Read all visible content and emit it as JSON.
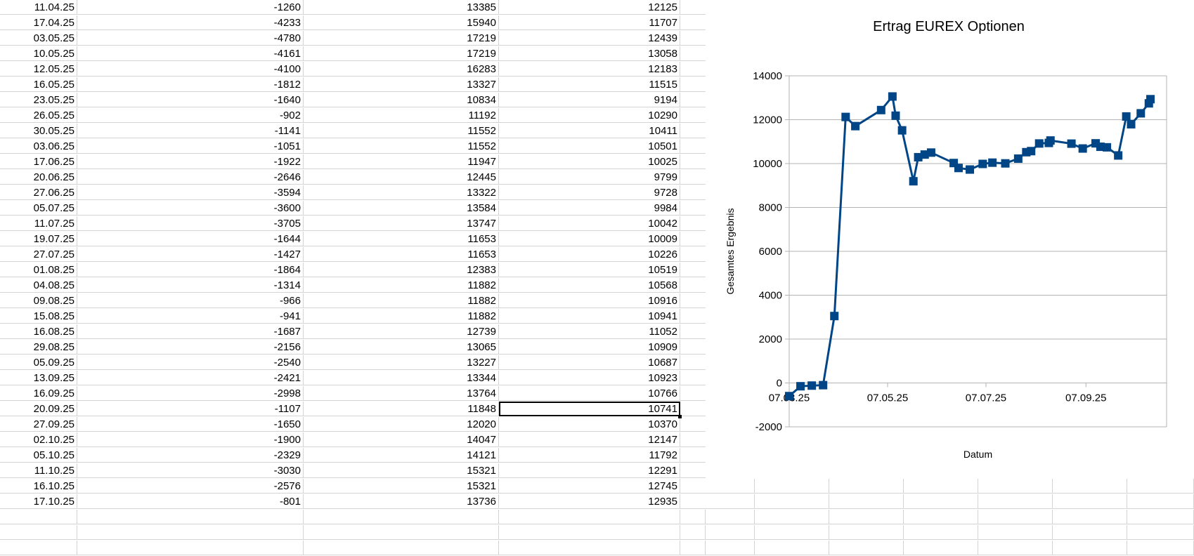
{
  "sheet": {
    "rows": [
      [
        "11.04.25",
        "-1260",
        "13385",
        "12125"
      ],
      [
        "17.04.25",
        "-4233",
        "15940",
        "11707"
      ],
      [
        "03.05.25",
        "-4780",
        "17219",
        "12439"
      ],
      [
        "10.05.25",
        "-4161",
        "17219",
        "13058"
      ],
      [
        "12.05.25",
        "-4100",
        "16283",
        "12183"
      ],
      [
        "16.05.25",
        "-1812",
        "13327",
        "11515"
      ],
      [
        "23.05.25",
        "-1640",
        "10834",
        "9194"
      ],
      [
        "26.05.25",
        "-902",
        "11192",
        "10290"
      ],
      [
        "30.05.25",
        "-1141",
        "11552",
        "10411"
      ],
      [
        "03.06.25",
        "-1051",
        "11552",
        "10501"
      ],
      [
        "17.06.25",
        "-1922",
        "11947",
        "10025"
      ],
      [
        "20.06.25",
        "-2646",
        "12445",
        "9799"
      ],
      [
        "27.06.25",
        "-3594",
        "13322",
        "9728"
      ],
      [
        "05.07.25",
        "-3600",
        "13584",
        "9984"
      ],
      [
        "11.07.25",
        "-3705",
        "13747",
        "10042"
      ],
      [
        "19.07.25",
        "-1644",
        "11653",
        "10009"
      ],
      [
        "27.07.25",
        "-1427",
        "11653",
        "10226"
      ],
      [
        "01.08.25",
        "-1864",
        "12383",
        "10519"
      ],
      [
        "04.08.25",
        "-1314",
        "11882",
        "10568"
      ],
      [
        "09.08.25",
        "-966",
        "11882",
        "10916"
      ],
      [
        "15.08.25",
        "-941",
        "11882",
        "10941"
      ],
      [
        "16.08.25",
        "-1687",
        "12739",
        "11052"
      ],
      [
        "29.08.25",
        "-2156",
        "13065",
        "10909"
      ],
      [
        "05.09.25",
        "-2540",
        "13227",
        "10687"
      ],
      [
        "13.09.25",
        "-2421",
        "13344",
        "10923"
      ],
      [
        "16.09.25",
        "-2998",
        "13764",
        "10766"
      ],
      [
        "20.09.25",
        "-1107",
        "11848",
        "10741"
      ],
      [
        "27.09.25",
        "-1650",
        "12020",
        "10370"
      ],
      [
        "02.10.25",
        "-1900",
        "14047",
        "12147"
      ],
      [
        "05.10.25",
        "-2329",
        "14121",
        "11792"
      ],
      [
        "11.10.25",
        "-3030",
        "15321",
        "12291"
      ],
      [
        "16.10.25",
        "-2576",
        "15321",
        "12745"
      ],
      [
        "17.10.25",
        "-801",
        "13736",
        "12935"
      ]
    ],
    "selected_cell": {
      "row": 26,
      "col": 3
    }
  },
  "chart_data": {
    "type": "line",
    "title": "Ertrag EUREX Optionen",
    "xlabel": "Datum",
    "ylabel": "Gesamtes Ergebnis",
    "ylim": [
      -2000,
      14000
    ],
    "y_ticks": [
      -2000,
      0,
      2000,
      4000,
      6000,
      8000,
      10000,
      12000,
      14000
    ],
    "x_ticks": [
      "07.03.25",
      "07.05.25",
      "07.07.25",
      "07.09.25"
    ],
    "x_range": [
      "07.03.25",
      "27.10.25"
    ],
    "grid": true,
    "marker": "square",
    "color": "#004586",
    "series": [
      {
        "points": [
          [
            "07.03.25",
            -600
          ],
          [
            "14.03.25",
            -150
          ],
          [
            "21.03.25",
            -120
          ],
          [
            "28.03.25",
            -100
          ],
          [
            "04.04.25",
            3050
          ],
          [
            "11.04.25",
            12125
          ],
          [
            "17.04.25",
            11707
          ],
          [
            "03.05.25",
            12439
          ],
          [
            "10.05.25",
            13058
          ],
          [
            "12.05.25",
            12183
          ],
          [
            "16.05.25",
            11515
          ],
          [
            "23.05.25",
            9194
          ],
          [
            "26.05.25",
            10290
          ],
          [
            "30.05.25",
            10411
          ],
          [
            "03.06.25",
            10501
          ],
          [
            "17.06.25",
            10025
          ],
          [
            "20.06.25",
            9799
          ],
          [
            "27.06.25",
            9728
          ],
          [
            "05.07.25",
            9984
          ],
          [
            "11.07.25",
            10042
          ],
          [
            "19.07.25",
            10009
          ],
          [
            "27.07.25",
            10226
          ],
          [
            "01.08.25",
            10519
          ],
          [
            "04.08.25",
            10568
          ],
          [
            "09.08.25",
            10916
          ],
          [
            "15.08.25",
            10941
          ],
          [
            "16.08.25",
            11052
          ],
          [
            "29.08.25",
            10909
          ],
          [
            "05.09.25",
            10687
          ],
          [
            "13.09.25",
            10923
          ],
          [
            "16.09.25",
            10766
          ],
          [
            "20.09.25",
            10741
          ],
          [
            "27.09.25",
            10370
          ],
          [
            "02.10.25",
            12147
          ],
          [
            "05.10.25",
            11792
          ],
          [
            "11.10.25",
            12291
          ],
          [
            "16.10.25",
            12745
          ],
          [
            "17.10.25",
            12935
          ]
        ]
      }
    ]
  }
}
